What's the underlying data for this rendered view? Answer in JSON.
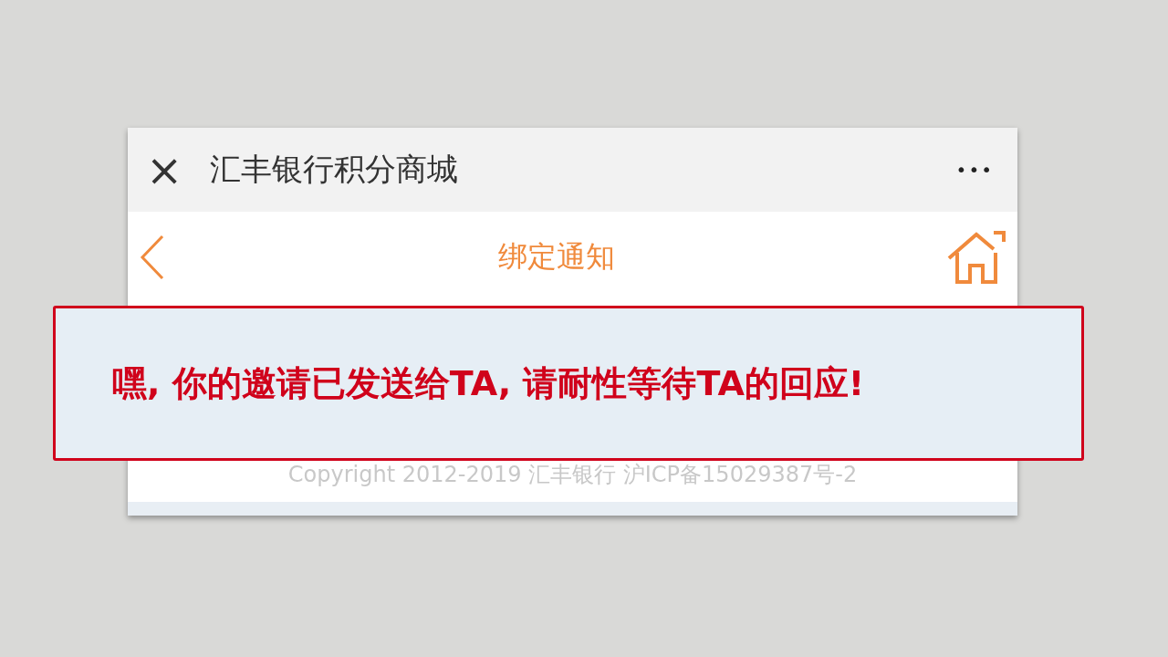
{
  "window": {
    "title": "汇丰银行积分商城",
    "close": "×",
    "more": "•••"
  },
  "nav": {
    "title": "绑定通知"
  },
  "footer": {
    "copyright": "Copyright 2012-2019 汇丰银行 沪ICP备15029387号-2"
  },
  "callout": {
    "text": "嘿, 你的邀请已发送给TA, 请耐性等待TA的回应!"
  }
}
